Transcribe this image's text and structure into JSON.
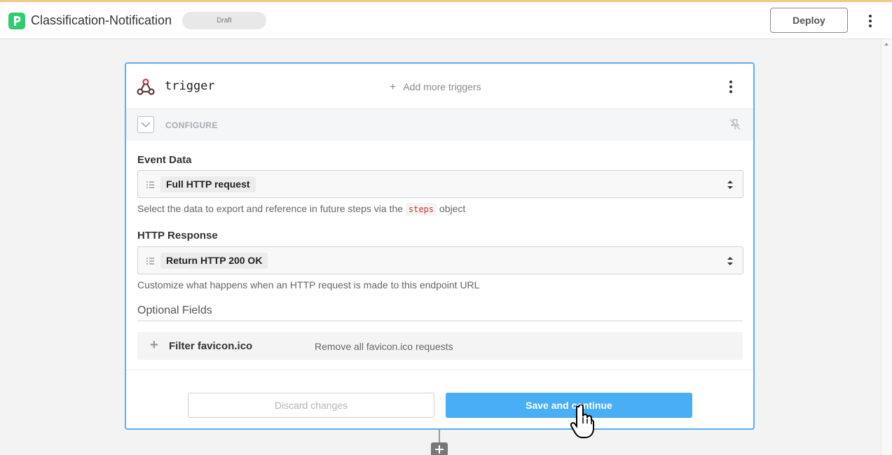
{
  "header": {
    "title": "Classification-Notification",
    "status_badge": "Draft",
    "deploy_label": "Deploy"
  },
  "trigger_card": {
    "title": "trigger",
    "add_triggers_label": "Add more triggers",
    "configure_label": "CONFIGURE",
    "event_data": {
      "label": "Event Data",
      "value": "Full HTTP request",
      "help_prefix": "Select the data to export and reference in future steps via the",
      "help_code": "steps",
      "help_suffix": "object"
    },
    "http_response": {
      "label": "HTTP Response",
      "value": "Return HTTP 200 OK",
      "help": "Customize what happens when an HTTP request is made to this endpoint URL"
    },
    "optional_fields": {
      "title": "Optional Fields",
      "items": [
        {
          "name": "Filter favicon.ico",
          "description": "Remove all favicon.ico requests"
        }
      ]
    },
    "discard_label": "Discard changes",
    "save_label": "Save and continue"
  },
  "colors": {
    "brand": "#2ecc71",
    "accent_blue": "#4aaef4",
    "card_border": "#5bb0f0"
  },
  "icons": {
    "app_logo": "pipedream-logo",
    "trigger": "webhook-icon",
    "pin": "unpin-icon",
    "menu": "kebab-menu-icon",
    "cursor": "hand-pointer-cursor"
  }
}
